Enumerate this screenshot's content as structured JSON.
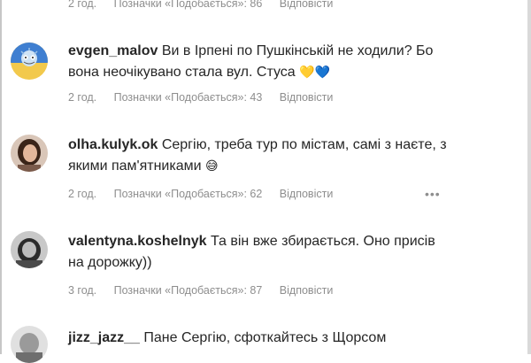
{
  "top_meta": {
    "time": "2 год.",
    "likes": "Позначки «Подобається»: 86",
    "reply": "Відповісти"
  },
  "comments": [
    {
      "username": "evgen_malov",
      "text_line1": "Ви в Ірпені по Пушкінській не ходили? Бо",
      "text_line2": "вона неочікувано стала вул. Стуса ",
      "emoji": "💛💙",
      "time": "2 год.",
      "likes": "Позначки «Подобається»: 43",
      "reply": "Відповісти"
    },
    {
      "username": "olha.kulyk.ok",
      "text_line1": "Сергію, треба тур по містам, самі з наєте, з",
      "text_line2": "якими пам'ятниками ",
      "emoji": "😅",
      "time": "2 год.",
      "likes": "Позначки «Подобається»: 62",
      "reply": "Відповісти",
      "more": "•••"
    },
    {
      "username": "valentyna.koshelnyk",
      "text_line1": "Та він вже збирається. Оно присів",
      "text_line2": "на дорожку))",
      "time": "3 год.",
      "likes": "Позначки «Подобається»: 87",
      "reply": "Відповісти"
    },
    {
      "username": "jizz_jazz__",
      "text_line1": "Пане Сергію, сфоткайтесь з Щорсом"
    }
  ]
}
